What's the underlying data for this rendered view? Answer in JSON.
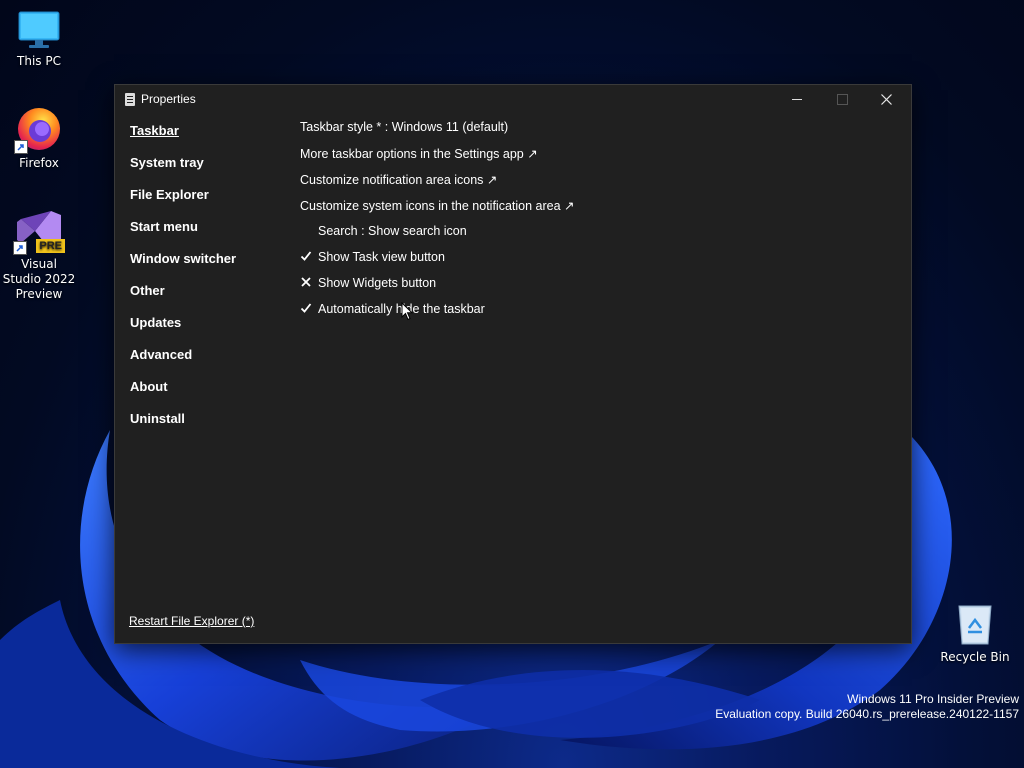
{
  "desktop": {
    "icons": [
      {
        "label": "This PC",
        "icon": "monitor-icon"
      },
      {
        "label": "Firefox",
        "icon": "firefox-icon"
      },
      {
        "label": "Visual Studio 2022 Preview",
        "icon": "visual-studio-icon",
        "badge": "PRE"
      },
      {
        "label": "Recycle Bin",
        "icon": "recycle-bin-icon"
      }
    ],
    "watermark": {
      "line1": "Windows 11 Pro Insider Preview",
      "line2": "Evaluation copy. Build 26040.rs_prerelease.240122-1157"
    }
  },
  "window": {
    "title": "Properties",
    "nav": [
      {
        "label": "Taskbar",
        "active": true
      },
      {
        "label": "System tray"
      },
      {
        "label": "File Explorer"
      },
      {
        "label": "Start menu"
      },
      {
        "label": "Window switcher"
      },
      {
        "label": "Other"
      },
      {
        "label": "Updates"
      },
      {
        "label": "Advanced"
      },
      {
        "label": "About"
      },
      {
        "label": "Uninstall"
      }
    ],
    "settings": [
      {
        "text": "Taskbar style * : Windows 11 (default)",
        "mark": ""
      },
      {
        "text": "More taskbar options in the Settings app ↗",
        "mark": ""
      },
      {
        "text": "Customize notification area icons ↗",
        "mark": ""
      },
      {
        "text": "Customize system icons in the notification area ↗",
        "mark": ""
      },
      {
        "text": "Search : Show search icon",
        "mark": "none"
      },
      {
        "text": "Show Task view button",
        "mark": "check"
      },
      {
        "text": "Show Widgets button",
        "mark": "cross"
      },
      {
        "text": "Automatically hide the taskbar",
        "mark": "check"
      }
    ],
    "restart_link": "Restart File Explorer (*)"
  },
  "colors": {
    "window_bg": "#202020",
    "accent_blue": "#1a4fff"
  }
}
